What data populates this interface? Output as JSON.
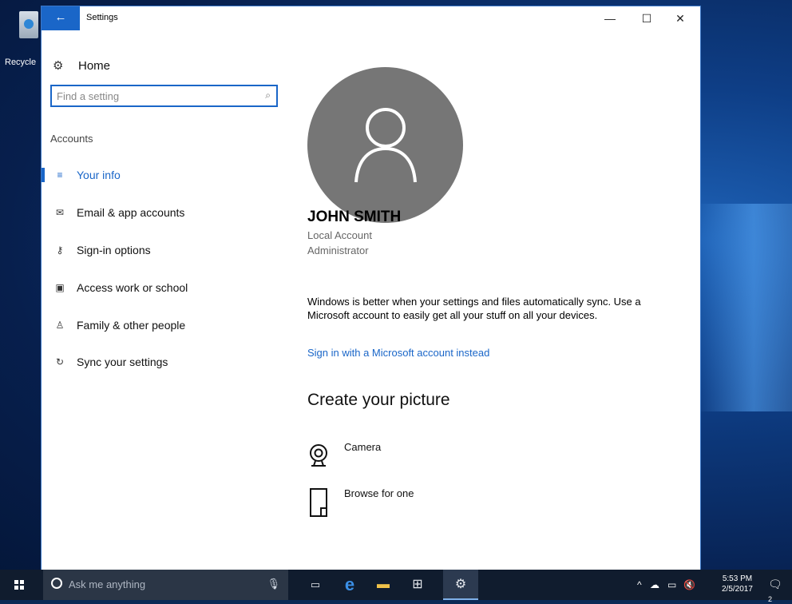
{
  "desktop": {
    "recycle_label": "Recycle"
  },
  "window": {
    "title": "Settings",
    "back_icon": "←",
    "minimize_icon": "—",
    "maximize_icon": "☐",
    "close_icon": "✕"
  },
  "sidebar": {
    "home_label": "Home",
    "search_placeholder": "Find a setting",
    "section": "Accounts",
    "items": [
      {
        "label": "Your info",
        "icon": "≡"
      },
      {
        "label": "Email & app accounts",
        "icon": "✉"
      },
      {
        "label": "Sign-in options",
        "icon": "⚷"
      },
      {
        "label": "Access work or school",
        "icon": "▣"
      },
      {
        "label": "Family & other people",
        "icon": "♙"
      },
      {
        "label": "Sync your settings",
        "icon": "↻"
      }
    ]
  },
  "content": {
    "user_name": "JOHN SMITH",
    "account_type": "Local Account",
    "role": "Administrator",
    "sync_text": "Windows is better when your settings and files automatically sync. Use a Microsoft account to easily get all your stuff on all your devices.",
    "ms_link": "Sign in with a Microsoft account instead",
    "create_heading": "Create your picture",
    "options": [
      {
        "label": "Camera"
      },
      {
        "label": "Browse for one"
      }
    ]
  },
  "taskbar": {
    "search_placeholder": "Ask me anything",
    "time": "5:53 PM",
    "date": "2/5/2017",
    "notification_count": "2"
  }
}
